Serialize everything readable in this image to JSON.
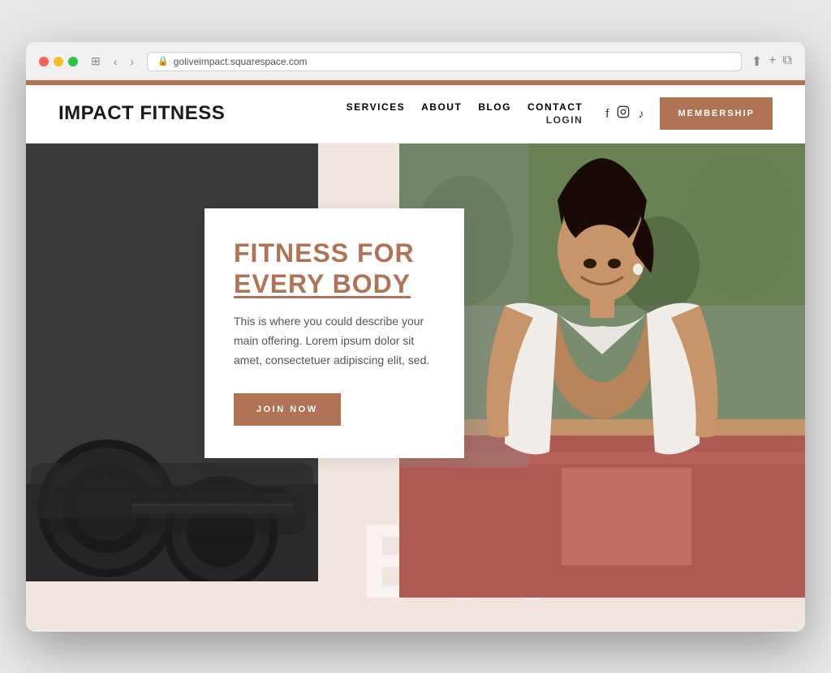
{
  "browser": {
    "url": "goliveimpact.squarespace.com"
  },
  "navbar": {
    "brand": "IMPACT FITNESS",
    "links": [
      "SERVICES",
      "ABOUT",
      "BLOG",
      "CONTACT"
    ],
    "login": "LOGIN",
    "cta": "MEMBERSHIP"
  },
  "hero": {
    "title_line1": "FITNESS FOR",
    "title_line2": "EVERY BODY",
    "description": "This is where you could describe your main offering. Lorem ipsum dolor sit amet, consectetuer adipiscing elit, sed.",
    "cta": "JOIN NOW",
    "bg_text": "ESS IMPAC"
  }
}
